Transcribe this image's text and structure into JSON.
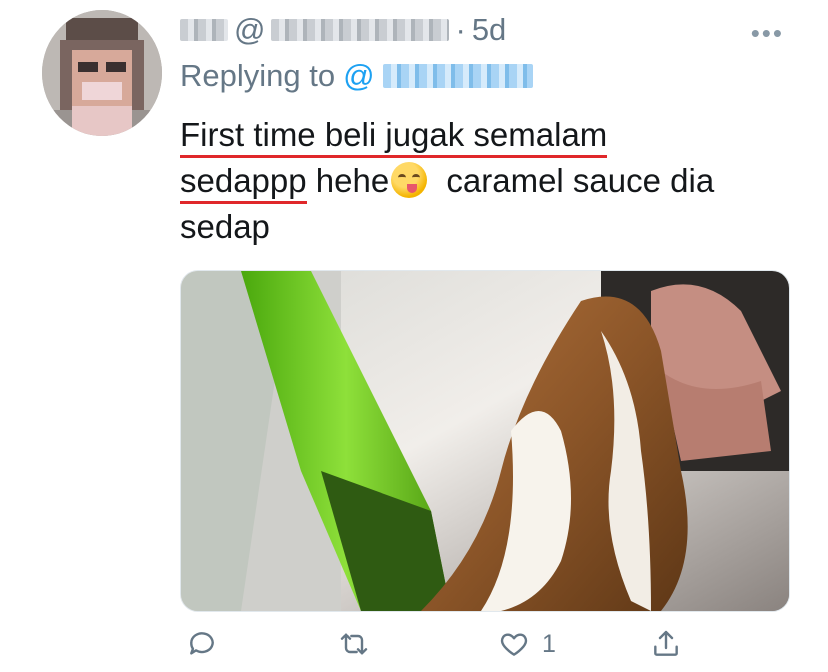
{
  "tweet": {
    "author_handle_prefix": "@",
    "time_separator": "·",
    "timestamp": "5d",
    "more_label": "•••",
    "replying_to_label": "Replying to",
    "replying_to_prefix": "@",
    "text_lines": [
      "First time beli jugak semalam",
      "sedappp",
      "hehe",
      "caramel sauce dia",
      "sedap"
    ],
    "emoji_name": "face-savoring-food"
  },
  "actions": {
    "reply_count": "",
    "retweet_count": "",
    "like_count": "1",
    "share_label": ""
  },
  "colors": {
    "text": "#14171a",
    "muted": "#657786",
    "accent": "#1da1f2",
    "annotation_red": "#e0282a",
    "cone_green": "#6fc21d"
  }
}
